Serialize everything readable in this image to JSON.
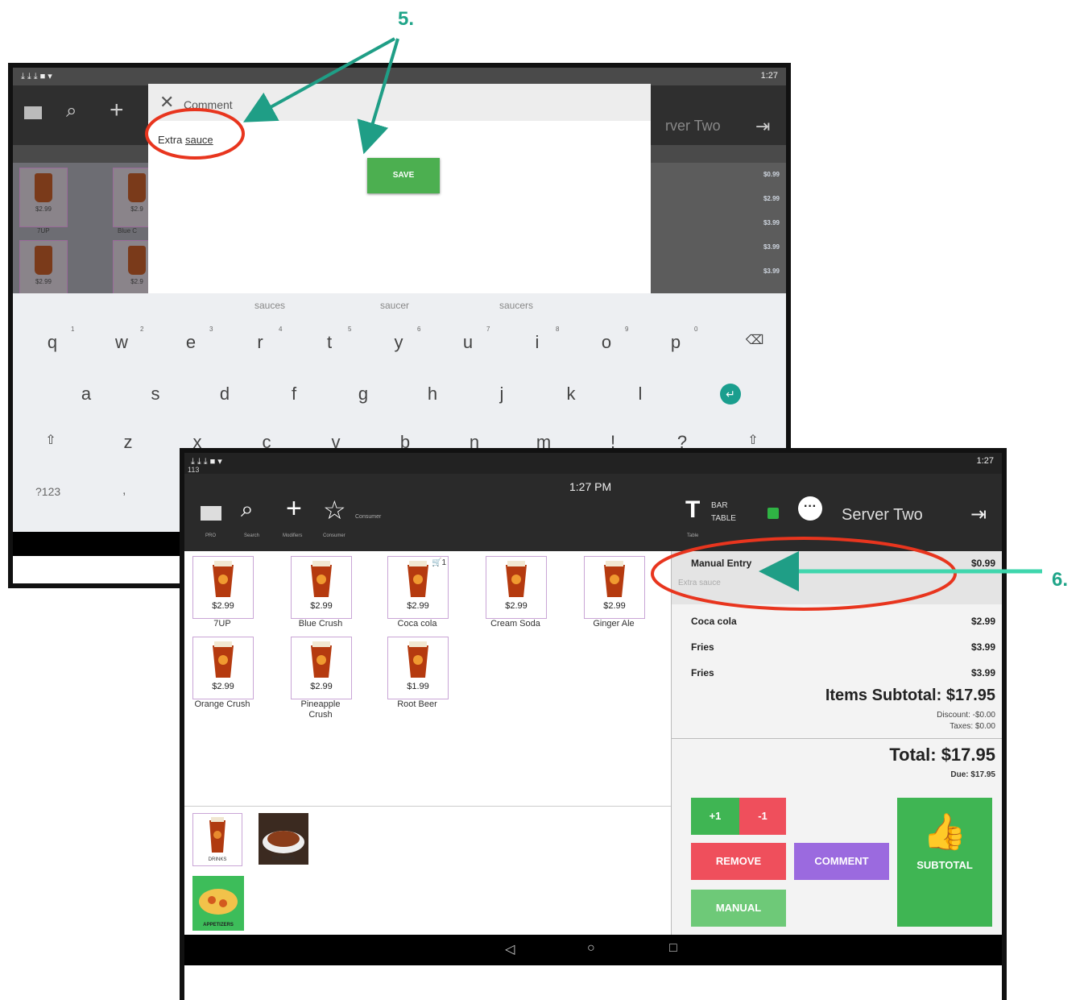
{
  "callouts": {
    "step5": "5.",
    "step6": "6."
  },
  "screen1": {
    "status_time": "1:27",
    "toolbar_partial_name": "rver Two",
    "dialog": {
      "title": "Comment",
      "text_plain": "Extra ",
      "text_underlined": "sauce",
      "save_label": "SAVE"
    },
    "dim_prices": [
      "$2.99",
      "$2.9",
      "$2.99",
      "$2.9"
    ],
    "dim_names": [
      "7UP",
      "Blue C"
    ],
    "dim_right_prices": [
      "$0.99",
      "$2.99",
      "$3.99",
      "$3.99",
      "$3.99"
    ],
    "suggestions": [
      "sauces",
      "saucer",
      "saucers"
    ],
    "keys_row1": [
      "q",
      "w",
      "e",
      "r",
      "t",
      "y",
      "u",
      "i",
      "o",
      "p"
    ],
    "hints_row1": [
      "1",
      "2",
      "3",
      "4",
      "5",
      "6",
      "7",
      "8",
      "9",
      "0"
    ],
    "keys_row2": [
      "a",
      "s",
      "d",
      "f",
      "g",
      "h",
      "j",
      "k",
      "l"
    ],
    "keys_row3": [
      "z",
      "x",
      "c",
      "v",
      "b",
      "n",
      "m",
      "!",
      "?"
    ],
    "symbols_key": "?123",
    "comma_key": ","
  },
  "screen2": {
    "status_left": "113",
    "status_time_right": "1:27",
    "clock": "1:27 PM",
    "toolbar": {
      "customer_label": "Consumer",
      "sub_labels": [
        "PRO",
        "Search",
        "Modifiers",
        "Consumer"
      ],
      "table_label_1": "BAR",
      "table_label_2": "TABLE",
      "table_sub": "Table",
      "server_name": "Server Two"
    },
    "items": [
      {
        "name": "7UP",
        "price": "$2.99"
      },
      {
        "name": "Blue Crush",
        "price": "$2.99"
      },
      {
        "name": "Coca cola",
        "price": "$2.99",
        "badge": "1"
      },
      {
        "name": "Cream Soda",
        "price": "$2.99"
      },
      {
        "name": "Ginger Ale",
        "price": "$2.99"
      },
      {
        "name": "Orange Crush",
        "price": "$2.99"
      },
      {
        "name": "Pineapple Crush",
        "price": "$2.99"
      },
      {
        "name": "Root Beer",
        "price": "$1.99"
      }
    ],
    "categories": [
      "DRINKS",
      "ENTREES",
      "APPETIZERS"
    ],
    "order": {
      "rows": [
        {
          "name": "Manual Entry",
          "price": "$0.99",
          "note": "Extra sauce"
        },
        {
          "name": "Coca cola",
          "price": "$2.99"
        },
        {
          "name": "Fries",
          "price": "$3.99"
        },
        {
          "name": "Fries",
          "price": "$3.99"
        }
      ],
      "items_subtotal": "Items Subtotal: $17.95",
      "discount": "Discount: -$0.00",
      "taxes": "Taxes: $0.00",
      "total": "Total: $17.95",
      "due": "Due: $17.95"
    },
    "buttons": {
      "plus": "+1",
      "minus": "-1",
      "remove": "REMOVE",
      "comment": "COMMENT",
      "manual": "MANUAL",
      "subtotal": "SUBTOTAL"
    }
  }
}
